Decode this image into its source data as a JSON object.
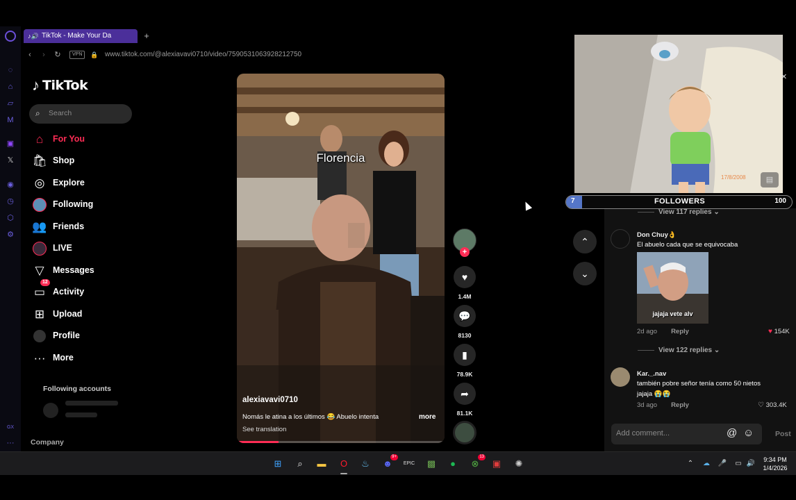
{
  "browser": {
    "tab_title": "TikTok - Make Your Da",
    "new_tab": "+",
    "vpn_label": "VPN",
    "url": "www.tiktok.com/@alexiavavi0710/video/7590531063928212750"
  },
  "tiktok": {
    "logo_text": "TikTok",
    "search_placeholder": "Search",
    "nav": [
      {
        "label": "For You",
        "icon": "home-icon",
        "active": true
      },
      {
        "label": "Shop",
        "icon": "shop-icon"
      },
      {
        "label": "Explore",
        "icon": "compass-icon"
      },
      {
        "label": "Following",
        "icon": "following-avatar-icon"
      },
      {
        "label": "Friends",
        "icon": "friends-icon"
      },
      {
        "label": "LIVE",
        "icon": "live-avatar-icon"
      },
      {
        "label": "Messages",
        "icon": "messages-icon"
      },
      {
        "label": "Activity",
        "icon": "activity-icon",
        "badge": "12"
      },
      {
        "label": "Upload",
        "icon": "upload-icon"
      },
      {
        "label": "Profile",
        "icon": "profile-avatar-icon"
      },
      {
        "label": "More",
        "icon": "more-icon"
      }
    ],
    "following_accounts": "Following accounts",
    "company": "Company"
  },
  "video": {
    "overlay_text": "Florencia",
    "username": "alexiavavi0710",
    "description": "Nomás le atina a los últimos 😂 Abuelo intenta",
    "more": "more",
    "see_translation": "See translation",
    "progress": 0.2
  },
  "actions": {
    "likes": "1.4M",
    "comments": "8130",
    "saves": "78.9K",
    "shares": "81.1K"
  },
  "overlay": {
    "photo_date": "17/8/2008",
    "followers_count": "7",
    "followers_label": "FOLLOWERS",
    "followers_goal": "100",
    "followers_fraction": 0.07
  },
  "comments_panel": {
    "view_replies_1": "View 117 replies",
    "comment1": {
      "user": "Don Chuy👌",
      "text": "El abuelo cada que se equivocaba",
      "gif_text": "jajaja vete alv",
      "time": "2d ago",
      "reply": "Reply",
      "likes": "154K"
    },
    "view_replies_2": "View 122 replies",
    "comment2": {
      "user": "Kar._.nav",
      "text": "también pobre señor tenía como 50 nietos jajaja 😭😭",
      "time": "3d ago",
      "reply": "Reply",
      "likes": "303.4K"
    },
    "add_comment_placeholder": "Add comment...",
    "post": "Post"
  },
  "taskbar": {
    "time": "9:34 PM",
    "date": "1/4/2026",
    "discord_badge": "9+",
    "xbox_badge": "13"
  },
  "colors": {
    "accent": "#fe2c55",
    "opera_purple": "#4b2f9a",
    "followers_bar": "#5576c8"
  }
}
